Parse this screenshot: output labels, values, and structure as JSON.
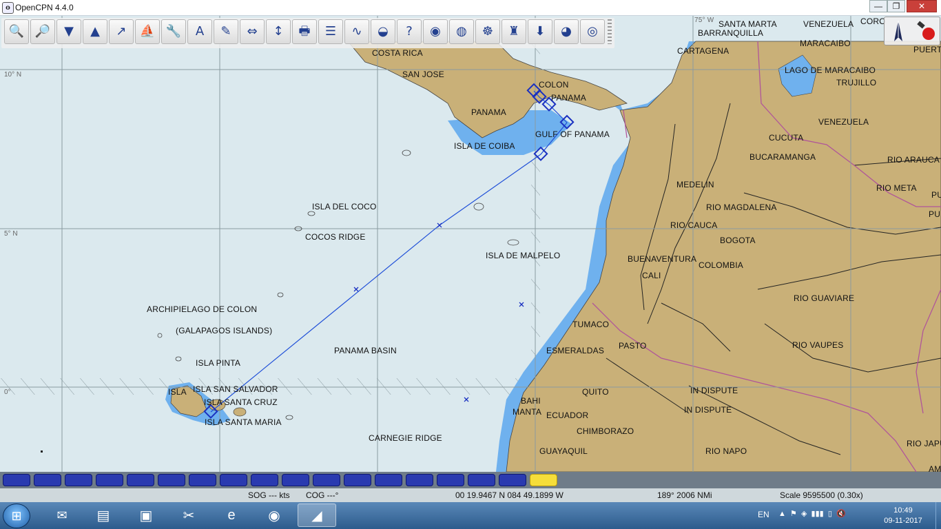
{
  "window": {
    "title": "OpenCPN 4.4.0",
    "minimize": "—",
    "maximize": "❐",
    "close": "✕"
  },
  "toolbar": [
    {
      "name": "zoom-in-button",
      "icon": "zoom-in-icon",
      "glyph": "🔍"
    },
    {
      "name": "zoom-out-button",
      "icon": "zoom-out-icon",
      "glyph": "🔎"
    },
    {
      "name": "scale-in-button",
      "icon": "funnel-down-icon",
      "glyph": "▼"
    },
    {
      "name": "scale-out-button",
      "icon": "pyramid-up-icon",
      "glyph": "▲"
    },
    {
      "name": "create-route-button",
      "icon": "route-icon",
      "glyph": "↗"
    },
    {
      "name": "auto-follow-button",
      "icon": "boat-icon",
      "glyph": "⛵"
    },
    {
      "name": "options-button",
      "icon": "wrench-icon",
      "glyph": "🔧"
    },
    {
      "name": "text-button",
      "icon": "text-add-icon",
      "glyph": "A"
    },
    {
      "name": "current-button",
      "icon": "pencil-icon",
      "glyph": "✎"
    },
    {
      "name": "tide-button",
      "icon": "tide-icon",
      "glyph": "⇔"
    },
    {
      "name": "measure-button",
      "icon": "measure-icon",
      "glyph": "↕"
    },
    {
      "name": "print-button",
      "icon": "printer-icon",
      "glyph": "🖶"
    },
    {
      "name": "route-manager-button",
      "icon": "list-icon",
      "glyph": "☰"
    },
    {
      "name": "track-button",
      "icon": "track-icon",
      "glyph": "∿"
    },
    {
      "name": "color-scheme-button",
      "icon": "sunset-icon",
      "glyph": "◒"
    },
    {
      "name": "help-button",
      "icon": "help-icon",
      "glyph": "?"
    },
    {
      "name": "ais-button",
      "icon": "target-icon",
      "glyph": "◉"
    },
    {
      "name": "google-earth-button",
      "icon": "globe-icon",
      "glyph": "◍"
    },
    {
      "name": "mob-button",
      "icon": "mob-icon",
      "glyph": "☸"
    },
    {
      "name": "lighthouse-button",
      "icon": "lighthouse-icon",
      "glyph": "♜"
    },
    {
      "name": "download-button",
      "icon": "download-icon",
      "glyph": "⬇"
    },
    {
      "name": "world-button",
      "icon": "world-icon",
      "glyph": "◕"
    },
    {
      "name": "lifebuoy-button",
      "icon": "lifebuoy-icon",
      "glyph": "◎"
    }
  ],
  "map": {
    "latitudes": [
      "10° N",
      "5° N",
      "0°"
    ],
    "labels": [
      {
        "text": "SANTA MARTA",
        "id": "label-santa-marta"
      },
      {
        "text": "VENEZUELA",
        "id": "label-venezuela-top"
      },
      {
        "text": "CORO",
        "id": "label-coro"
      },
      {
        "text": "PUERT",
        "id": "label-puerto"
      },
      {
        "text": "BARRANQUILLA",
        "id": "label-barranquilla"
      },
      {
        "text": "COSTA RICA",
        "id": "label-costa-rica"
      },
      {
        "text": "CARTAGENA",
        "id": "label-cartagena"
      },
      {
        "text": "MARACAIBO",
        "id": "label-maracaibo"
      },
      {
        "text": "SAN JOSE",
        "id": "label-san-jose"
      },
      {
        "text": "LAGO DE MARACAIBO",
        "id": "label-lago"
      },
      {
        "text": "TRUJILLO",
        "id": "label-trujillo"
      },
      {
        "text": "COLON",
        "id": "label-colon"
      },
      {
        "text": "PANAMA",
        "id": "label-panama-city"
      },
      {
        "text": "PANAMA",
        "id": "label-panama"
      },
      {
        "text": "VENEZUELA",
        "id": "label-venezuela"
      },
      {
        "text": "CUCUTA",
        "id": "label-cucuta"
      },
      {
        "text": "GULF OF PANAMA",
        "id": "label-gulf"
      },
      {
        "text": "ISLA DE COIBA",
        "id": "label-coiba"
      },
      {
        "text": "BUCARAMANGA",
        "id": "label-bucaramanga"
      },
      {
        "text": "RIO ARAUCA",
        "id": "label-rio-arauca"
      },
      {
        "text": "MEDELIN",
        "id": "label-medelin"
      },
      {
        "text": "RIO META",
        "id": "label-rio-meta"
      },
      {
        "text": "ISLA DEL COCO",
        "id": "label-isla-coco"
      },
      {
        "text": "RIO MAGDALENA",
        "id": "label-rio-magdalena"
      },
      {
        "text": "RIO CAUCA",
        "id": "label-rio-cauca"
      },
      {
        "text": "COCOS RIDGE",
        "id": "label-cocos-ridge"
      },
      {
        "text": "BOGOTA",
        "id": "label-bogota"
      },
      {
        "text": "ISLA DE MALPELO",
        "id": "label-malpelo"
      },
      {
        "text": "BUENAVENTURA",
        "id": "label-buenaventura"
      },
      {
        "text": "COLOMBIA",
        "id": "label-colombia"
      },
      {
        "text": "CALI",
        "id": "label-cali"
      },
      {
        "text": "ARCHIPIELAGO DE COLON",
        "id": "label-archipielago"
      },
      {
        "text": "RIO GUAVIARE",
        "id": "label-rio-guaviare"
      },
      {
        "text": "TUMACO",
        "id": "label-tumaco"
      },
      {
        "text": "(GALAPAGOS ISLANDS)",
        "id": "label-galapagos"
      },
      {
        "text": "PASTO",
        "id": "label-pasto"
      },
      {
        "text": "RIO VAUPES",
        "id": "label-rio-vaupes"
      },
      {
        "text": "PANAMA BASIN",
        "id": "label-panama-basin"
      },
      {
        "text": "ESMERALDAS",
        "id": "label-esmeraldas"
      },
      {
        "text": "ISLA PINTA",
        "id": "label-isla-pinta"
      },
      {
        "text": "ISLA SAN SALVADOR",
        "id": "label-san-salvador"
      },
      {
        "text": "ISLA",
        "id": "label-isla"
      },
      {
        "text": "QUITO",
        "id": "label-quito"
      },
      {
        "text": "IN DISPUTE",
        "id": "label-dispute-1"
      },
      {
        "text": "ISLA SANTA CRUZ",
        "id": "label-santa-cruz"
      },
      {
        "text": "BAHI",
        "id": "label-bahi"
      },
      {
        "text": "MANTA",
        "id": "label-manta"
      },
      {
        "text": "IN DISPUTE",
        "id": "label-dispute-2"
      },
      {
        "text": "ECUADOR",
        "id": "label-ecuador"
      },
      {
        "text": "ISLA SANTA MARIA",
        "id": "label-santa-maria"
      },
      {
        "text": "CHIMBORAZO",
        "id": "label-chimborazo"
      },
      {
        "text": "CARNEGIE RIDGE",
        "id": "label-carnegie"
      },
      {
        "text": "GUAYAQUIL",
        "id": "label-guayaquil"
      },
      {
        "text": "RIO NAPO",
        "id": "label-rio-napo"
      },
      {
        "text": "RIO JAPU",
        "id": "label-rio-japu"
      },
      {
        "text": "AM",
        "id": "label-am"
      },
      {
        "text": "PU",
        "id": "label-pu"
      },
      {
        "text": "PUI",
        "id": "label-pui"
      },
      {
        "text": "75° W",
        "id": "label-75w"
      }
    ]
  },
  "colors": {
    "sea": "#dbe9ee",
    "shallow": "#6fb1ee",
    "land": "#c9b078",
    "route": "#2050d8",
    "border": "#b0559a"
  },
  "piano": {
    "keys": [
      "",
      "",
      "",
      "",
      "",
      "",
      "",
      "",
      "",
      "",
      "",
      "",
      "",
      "",
      "",
      "",
      "",
      ""
    ],
    "active_index": 17
  },
  "status": {
    "sog": "SOG --- kts",
    "cog": "COG ---°",
    "position": "00 19.9467 N   084 49.1899 W",
    "bearing": "189°  2006 NMi",
    "scale": "Scale 9595500 (0.30x)"
  },
  "taskbar": {
    "apps": [
      {
        "name": "explorer-taskbar-button",
        "icon": "folder-icon",
        "glyph": "▤"
      },
      {
        "name": "media-taskbar-button",
        "icon": "media-icon",
        "glyph": "▣"
      },
      {
        "name": "paint-taskbar-button",
        "icon": "paint-icon",
        "glyph": "✂"
      },
      {
        "name": "ie-taskbar-button",
        "icon": "ie-icon",
        "glyph": "e"
      },
      {
        "name": "chrome-taskbar-button",
        "icon": "chrome-icon",
        "glyph": "◉"
      },
      {
        "name": "opencpn-taskbar-button",
        "icon": "opencpn-icon",
        "glyph": "◢"
      }
    ],
    "language": "EN",
    "time": "10:49",
    "date": "09-11-2017"
  }
}
